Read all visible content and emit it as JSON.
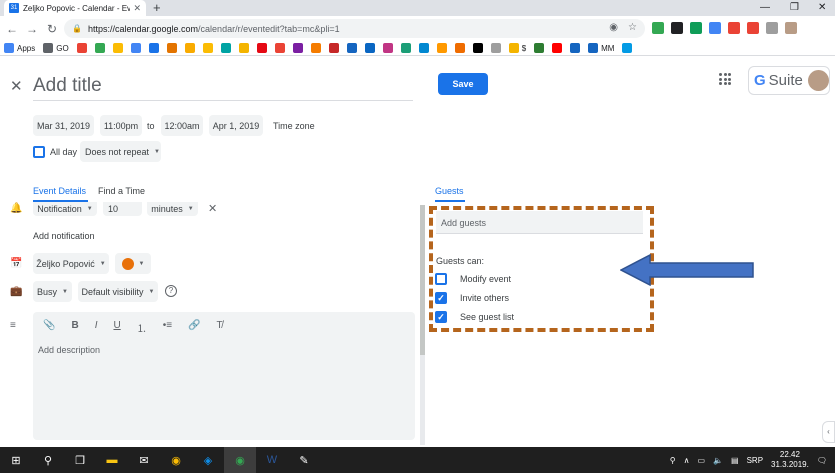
{
  "browser": {
    "tab_title": "Zeljko Popovic - Calendar - Event",
    "tab_favicon_text": "31",
    "url_host": "https://calendar.google.com",
    "url_path": "/calendar/r/eventedit?tab=mc&pli=1",
    "bookmarks": [
      {
        "label": "Apps",
        "color": "#4285f4"
      },
      {
        "label": "GO",
        "color": "#5f6368"
      },
      {
        "label": "",
        "color": "#ea4335"
      },
      {
        "label": "",
        "color": "#34a853"
      },
      {
        "label": "",
        "color": "#fbbc04"
      },
      {
        "label": "",
        "color": "#4285f4"
      },
      {
        "label": "",
        "color": "#1a73e8"
      },
      {
        "label": "",
        "color": "#e37400"
      },
      {
        "label": "",
        "color": "#f9ab00"
      },
      {
        "label": "",
        "color": "#fbbc04"
      },
      {
        "label": "",
        "color": "#00a3a3"
      },
      {
        "label": "",
        "color": "#f4b400"
      },
      {
        "label": "",
        "color": "#e50914"
      },
      {
        "label": "",
        "color": "#ea4335"
      },
      {
        "label": "",
        "color": "#7b1fa2"
      },
      {
        "label": "",
        "color": "#f57c00"
      },
      {
        "label": "",
        "color": "#c62828"
      },
      {
        "label": "",
        "color": "#1565c0"
      },
      {
        "label": "",
        "color": "#0a66c2"
      },
      {
        "label": "",
        "color": "#c13584"
      },
      {
        "label": "",
        "color": "#1b9e77"
      },
      {
        "label": "",
        "color": "#0288d1"
      },
      {
        "label": "",
        "color": "#ff9900"
      },
      {
        "label": "",
        "color": "#ef6c00"
      },
      {
        "label": "",
        "color": "#000000"
      },
      {
        "label": "",
        "color": "#9e9e9e"
      },
      {
        "label": "$",
        "color": "#f4b400"
      },
      {
        "label": "",
        "color": "#2e7d32"
      },
      {
        "label": "",
        "color": "#ff0000"
      },
      {
        "label": "",
        "color": "#1565c0"
      },
      {
        "label": "MM",
        "color": "#1565c0"
      },
      {
        "label": "",
        "color": "#039be5"
      }
    ],
    "extension_colors": [
      "#34a853",
      "#202124",
      "#0f9d58",
      "#4285f4",
      "#ea4335",
      "#ea4335",
      "#9e9e9e",
      "#b89c86"
    ]
  },
  "event": {
    "title_placeholder": "Add title",
    "save_label": "Save",
    "start_date": "Mar 31, 2019",
    "start_time": "11:00pm",
    "to_label": "to",
    "end_time": "12:00am",
    "end_date": "Apr 1, 2019",
    "timezone_label": "Time zone",
    "all_day_label": "All day",
    "repeat_value": "Does not repeat"
  },
  "brand": {
    "g": "G",
    "suite": "Suite"
  },
  "tabs": {
    "event_details": "Event Details",
    "find_time": "Find a Time",
    "guests": "Guests"
  },
  "details": {
    "notification_type": "Notification",
    "notification_value": "10",
    "notification_unit": "minutes",
    "add_notification": "Add notification",
    "calendar_owner": "Željko Popović",
    "calendar_color": "#e8710a",
    "busy_value": "Busy",
    "visibility_value": "Default visibility",
    "description_placeholder": "Add description"
  },
  "guests": {
    "add_placeholder": "Add guests",
    "can_label": "Guests can:",
    "permissions": [
      {
        "label": "Modify event",
        "checked": false
      },
      {
        "label": "Invite others",
        "checked": true
      },
      {
        "label": "See guest list",
        "checked": true
      }
    ]
  },
  "annotation": {
    "box_color": "#b5651d",
    "arrow_color": "#4472c4"
  },
  "taskbar": {
    "language": "SRP",
    "time": "22.42",
    "date": "31.3.2019."
  }
}
